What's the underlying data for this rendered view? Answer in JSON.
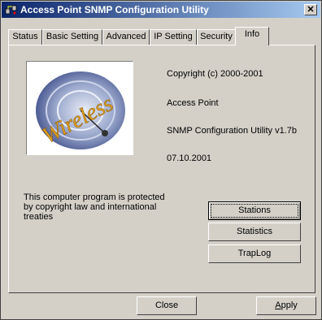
{
  "window": {
    "title": "Access Point SNMP Configuration Utility",
    "close_glyph": "✕"
  },
  "tabs": [
    {
      "label": "Status"
    },
    {
      "label": "Basic Setting"
    },
    {
      "label": "Advanced"
    },
    {
      "label": "IP Setting"
    },
    {
      "label": "Security"
    },
    {
      "label": "Info",
      "active": true
    }
  ],
  "info": {
    "logo_text": "Wireless",
    "copyright": "Copyright (c) 2000-2001",
    "product": "Access Point",
    "utility_version": "SNMP Configuration Utility v1.7b",
    "date": "07.10.2001",
    "notice": "This computer program is protected by copyright law and international treaties"
  },
  "buttons": {
    "stations": "Stations",
    "statistics": "Statistics",
    "traplog": "TrapLog"
  },
  "footer": {
    "close": "Close",
    "apply_first": "A",
    "apply_rest": "pply"
  }
}
